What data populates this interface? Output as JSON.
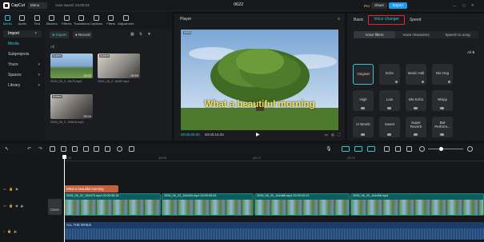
{
  "window": {
    "app_name": "CapCut",
    "menu_label": "Menu",
    "autosave_text": "Auto saved: 23:00:23",
    "project_title": "0622",
    "pro_label": "Pro",
    "share_label": "Share",
    "export_label": "Export",
    "accent_color": "#35c6d6",
    "export_color": "#1d9bf0"
  },
  "tool_tabs": [
    {
      "label": "Media",
      "icon": "media-icon",
      "active": true
    },
    {
      "label": "Audio",
      "icon": "audio-icon"
    },
    {
      "label": "Text",
      "icon": "text-icon"
    },
    {
      "label": "Stickers",
      "icon": "stickers-icon"
    },
    {
      "label": "Effects",
      "icon": "effects-icon"
    },
    {
      "label": "Transitions",
      "icon": "transitions-icon"
    },
    {
      "label": "Captions",
      "icon": "captions-icon"
    },
    {
      "label": "Filters",
      "icon": "filters-icon"
    },
    {
      "label": "Adjustment",
      "icon": "adjustment-icon"
    }
  ],
  "left_nav": {
    "import_label": "Import",
    "items": [
      "Media",
      "Subprojects",
      "Yours",
      "Spaces",
      "Library"
    ]
  },
  "media_panel": {
    "import_button": "Import",
    "record_button": "Record",
    "section_label": "All",
    "items": [
      {
        "added": "Added",
        "duration": "00:22",
        "name": "2026_06_2...8A70.mp4"
      },
      {
        "added": "Added",
        "duration": "00:09",
        "name": "2026_06_2...8A0F.mp4"
      },
      {
        "added": "Added",
        "duration": "00:24",
        "name": "2026_06_2...9940A.mp4"
      }
    ]
  },
  "player": {
    "title": "Player",
    "caption": "What a beautiful morning",
    "current_time": "00:00:00:00",
    "total_time": "00:00:15:20",
    "clip_tag": "0000"
  },
  "right_panel": {
    "tabs": [
      "Basic",
      "Voice changer",
      "Speed"
    ],
    "active_tab": "Voice changer",
    "subtabs": [
      "Voice filters",
      "Voice characters",
      "Speech to song"
    ],
    "active_subtab": "Voice filters",
    "filter_label": "All",
    "voice_filters": [
      "Original",
      "Echo",
      "Music Hall",
      "Mic Hog",
      "High",
      "Low",
      "Mic Echo",
      "Wispy",
      "In Womb",
      "Sweet",
      "Super Reverb",
      "Bat Perform..."
    ],
    "active_filter": "Original",
    "highlight_color": "#e0262c"
  },
  "timeline": {
    "ruler": [
      "00:00",
      "|00:05",
      "|00:10",
      "|00:15"
    ],
    "text_clip": "What a beautiful morning",
    "cover_label": "Cover",
    "video_clips": [
      "2026_06_22_164470.mp4  00:00:06:16",
      "2026_06_22_164449.mp4  00:00:05:04",
      "2026_06_22_164488.mp4  00:00:03:12",
      "2026_06_22_164496.mp4"
    ],
    "audio_clip": "ALL THE WHILE"
  }
}
